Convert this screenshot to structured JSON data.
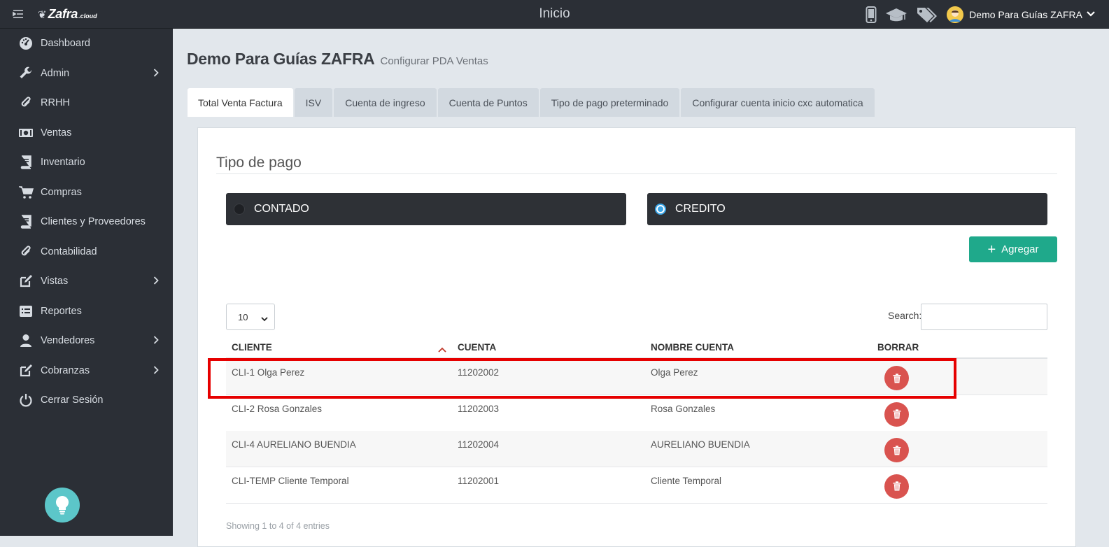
{
  "app": {
    "brand_name": "Zafra",
    "brand_suffix": ".cloud",
    "page_title": "Inicio",
    "user_name": "Demo Para Guías ZAFRA"
  },
  "sidebar": {
    "items": [
      {
        "label": "Dashboard",
        "icon": "dashboard-icon",
        "has_submenu": false
      },
      {
        "label": "Admin",
        "icon": "wrench-icon",
        "has_submenu": true
      },
      {
        "label": "RRHH",
        "icon": "paperclip-icon",
        "has_submenu": false
      },
      {
        "label": "Ventas",
        "icon": "money-icon",
        "has_submenu": false
      },
      {
        "label": "Inventario",
        "icon": "book-icon",
        "has_submenu": false
      },
      {
        "label": "Compras",
        "icon": "cart-icon",
        "has_submenu": false
      },
      {
        "label": "Clientes y Proveedores",
        "icon": "book-icon",
        "has_submenu": false
      },
      {
        "label": "Contabilidad",
        "icon": "paperclip-icon",
        "has_submenu": false
      },
      {
        "label": "Vistas",
        "icon": "edit-icon",
        "has_submenu": true
      },
      {
        "label": "Reportes",
        "icon": "list-icon",
        "has_submenu": false
      },
      {
        "label": "Vendedores",
        "icon": "user-icon",
        "has_submenu": true
      },
      {
        "label": "Cobranzas",
        "icon": "edit-icon",
        "has_submenu": true
      },
      {
        "label": "Cerrar Sesión",
        "icon": "power-icon",
        "has_submenu": false
      }
    ]
  },
  "page": {
    "title": "Demo Para Guías ZAFRA",
    "subtitle": "Configurar PDA Ventas"
  },
  "tabs": [
    {
      "label": "Total Venta Factura",
      "active": true
    },
    {
      "label": "ISV",
      "active": false
    },
    {
      "label": "Cuenta de ingreso",
      "active": false
    },
    {
      "label": "Cuenta de Puntos",
      "active": false
    },
    {
      "label": "Tipo de pago preterminado",
      "active": false
    },
    {
      "label": "Configurar cuenta inicio cxc automatica",
      "active": false
    }
  ],
  "payment": {
    "section_title": "Tipo de pago",
    "options": [
      {
        "label": "CONTADO",
        "selected": false
      },
      {
        "label": "CREDITO",
        "selected": true
      }
    ]
  },
  "actions": {
    "add_label": "Agregar"
  },
  "table": {
    "page_length": "10",
    "search_label": "Search:",
    "search_value": "",
    "columns": [
      "CLIENTE",
      "CUENTA",
      "NOMBRE CUENTA",
      "BORRAR"
    ],
    "rows": [
      {
        "cliente": "CLI-1 Olga Perez",
        "cuenta": "11202002",
        "nombre": "Olga Perez"
      },
      {
        "cliente": "CLI-2 Rosa Gonzales",
        "cuenta": "11202003",
        "nombre": "Rosa Gonzales"
      },
      {
        "cliente": "CLI-4 AURELIANO BUENDIA",
        "cuenta": "11202004",
        "nombre": "AURELIANO BUENDIA"
      },
      {
        "cliente": "CLI-TEMP Cliente Temporal",
        "cuenta": "11202001",
        "nombre": "Cliente Temporal"
      }
    ],
    "info": "Showing 1 to 4 of 4 entries"
  },
  "colors": {
    "sidebar_bg": "#2b2f36",
    "accent_green": "#1fa98b",
    "delete_red": "#d9534f",
    "highlight_red": "#e60000",
    "radio_blue": "#3aa6e8"
  }
}
